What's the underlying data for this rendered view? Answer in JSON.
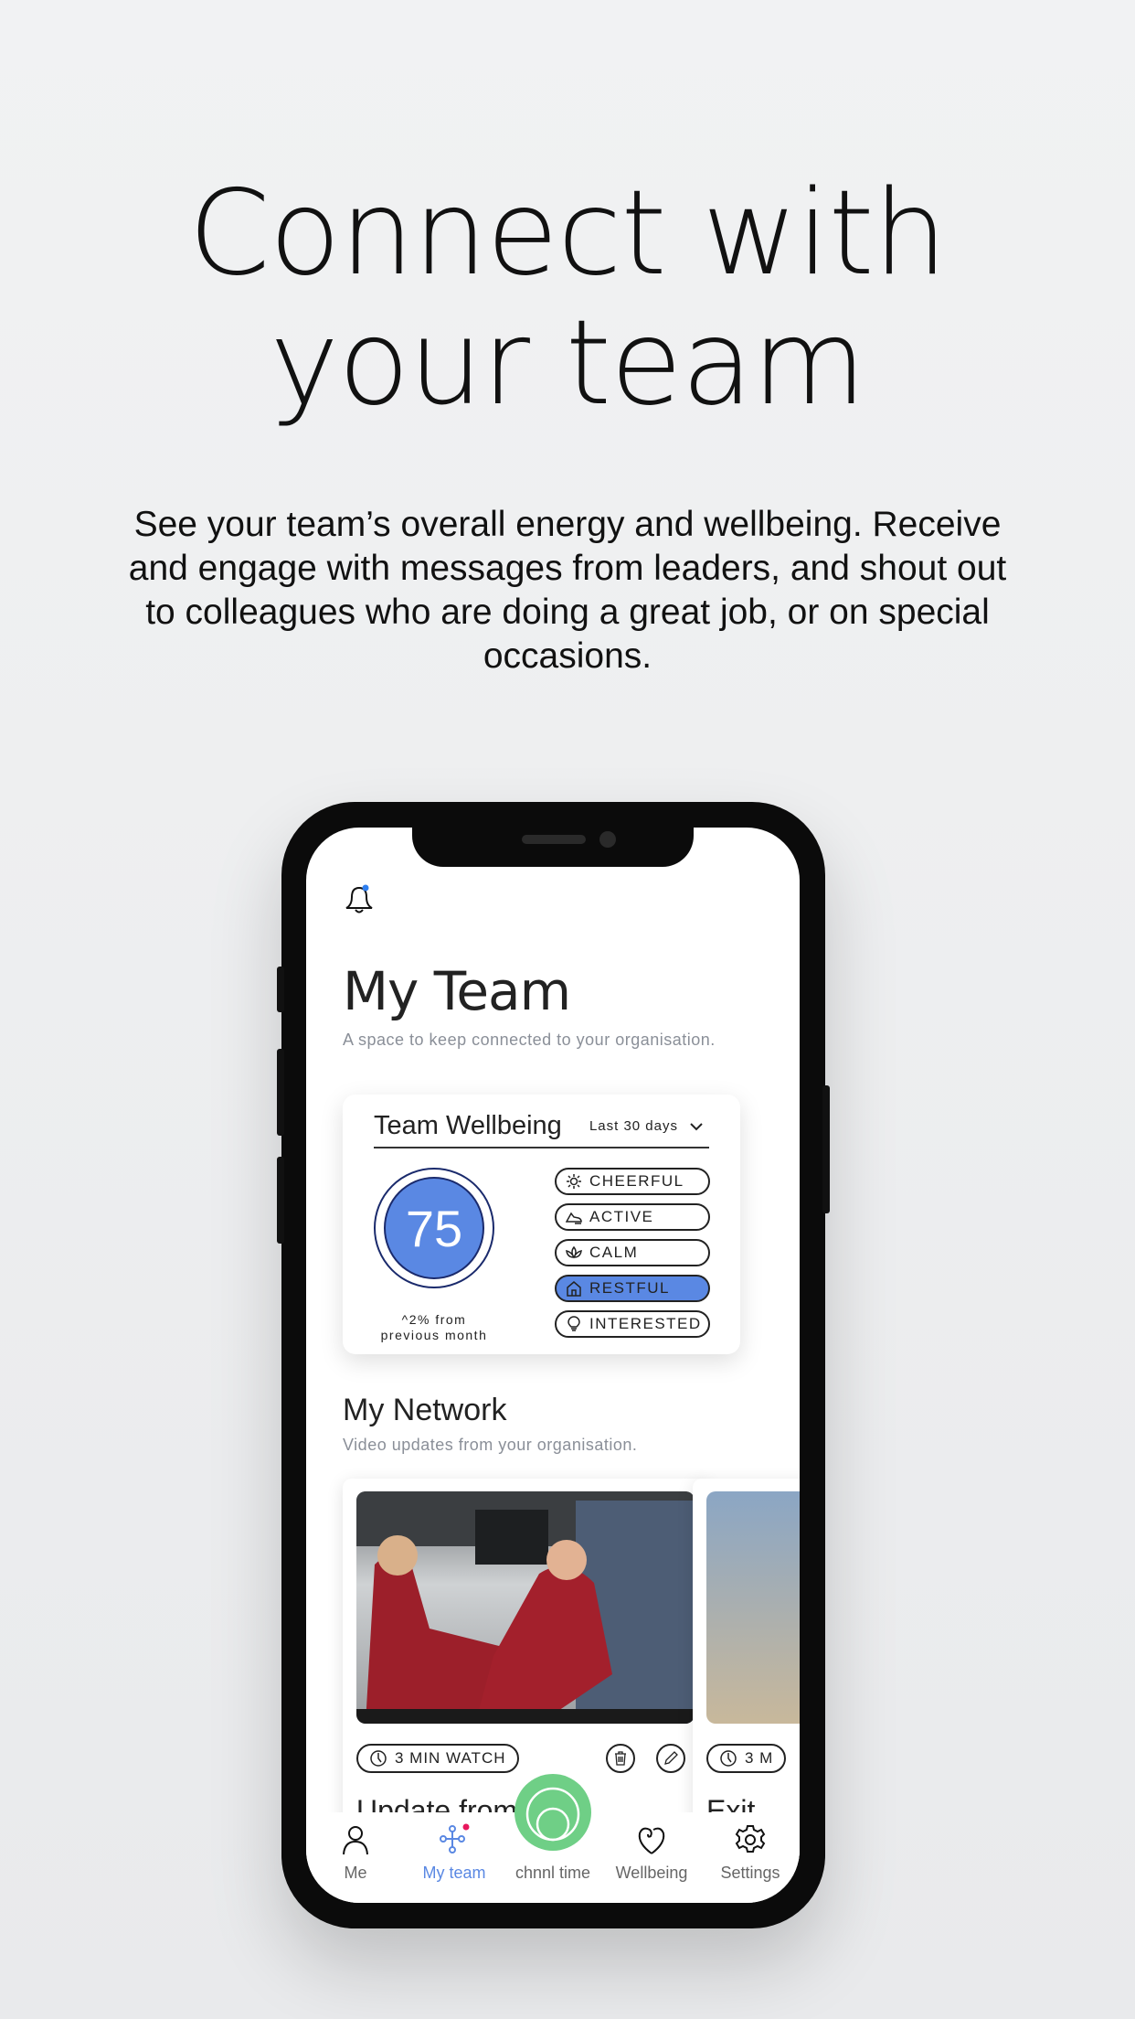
{
  "hero": {
    "title_line1": "Connect with",
    "title_line2": "your team",
    "description": "See your team’s overall energy and wellbeing. Receive and engage with messages from leaders, and shout out to colleagues who are doing a great job, or on special occasions."
  },
  "app": {
    "header": {
      "title": "My Team",
      "subtitle": "A space to keep connected to your organisation.",
      "notification_icon": "bell-icon"
    },
    "wellbeing": {
      "title": "Team Wellbeing",
      "period": "Last 30 days",
      "score": "75",
      "change_line1": "^2% from",
      "change_line2": "previous month",
      "moods": [
        {
          "label": "CHEERFUL",
          "icon": "sun-icon",
          "selected": false
        },
        {
          "label": "ACTIVE",
          "icon": "shoe-icon",
          "selected": false
        },
        {
          "label": "CALM",
          "icon": "lotus-icon",
          "selected": false
        },
        {
          "label": "RESTFUL",
          "icon": "home-icon",
          "selected": true
        },
        {
          "label": "INTERESTED",
          "icon": "lightbulb-icon",
          "selected": false
        }
      ]
    },
    "network": {
      "title": "My Network",
      "subtitle": "Video updates from your organisation.",
      "videos": [
        {
          "duration": "3 MIN WATCH",
          "title": "Update from C"
        },
        {
          "duration": "3 M",
          "title": "Exit"
        }
      ]
    },
    "tabs": [
      {
        "label": "Me"
      },
      {
        "label": "My team",
        "active": true
      },
      {
        "label": "chnnl time"
      },
      {
        "label": "Wellbeing"
      },
      {
        "label": "Settings"
      }
    ],
    "colors": {
      "accent": "#5a88e3",
      "green": "#6fcf86",
      "notification": "#e8175d"
    }
  }
}
